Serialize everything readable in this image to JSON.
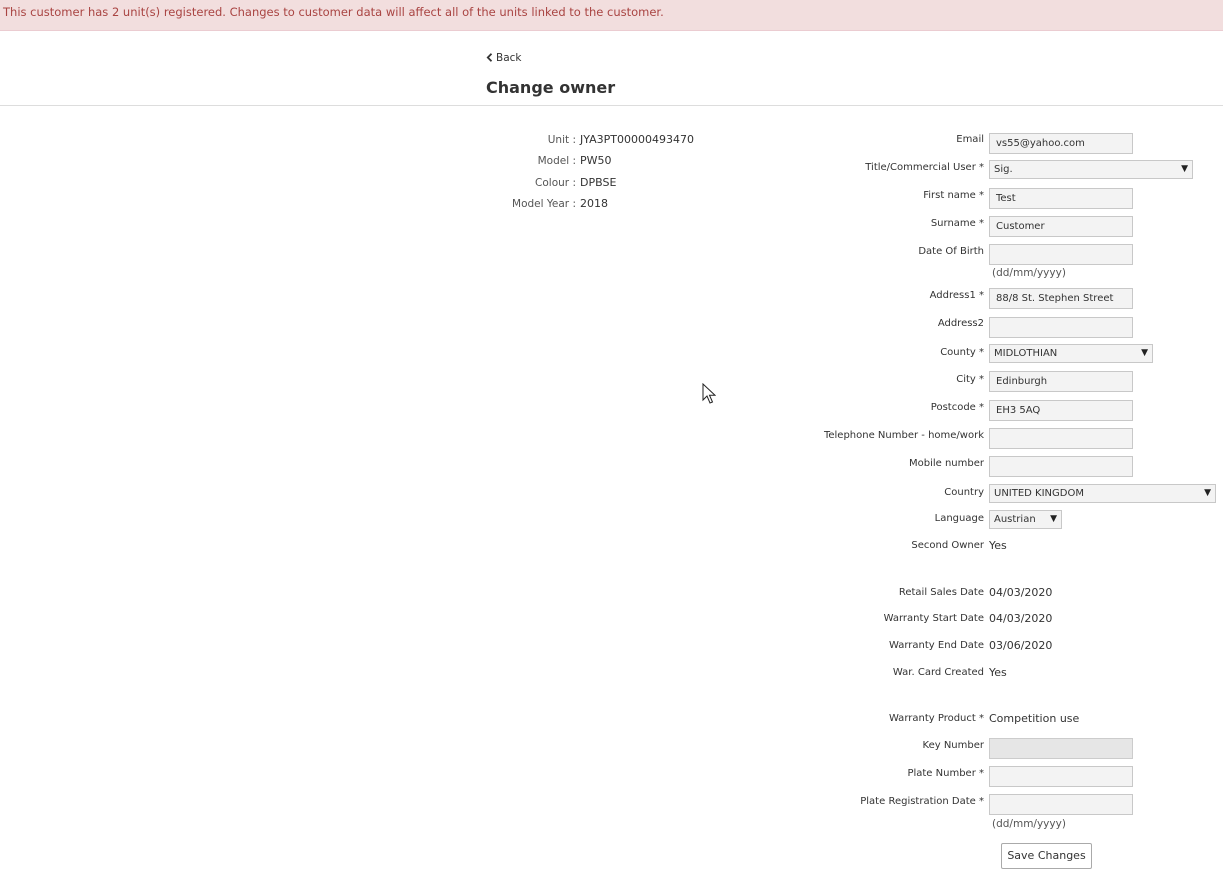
{
  "banner": {
    "message": "This customer has 2 unit(s) registered. Changes to customer data will affect all of the units linked to the customer."
  },
  "nav": {
    "back_label": "Back"
  },
  "page": {
    "title": "Change owner"
  },
  "unit_info": {
    "unit_label": "Unit :",
    "unit_value": "JYA3PT00000493470",
    "model_label": "Model :",
    "model_value": "PW50",
    "colour_label": "Colour :",
    "colour_value": "DPBSE",
    "model_year_label": "Model Year :",
    "model_year_value": "2018"
  },
  "form": {
    "email": {
      "label": "Email",
      "value": "vs55@yahoo.com"
    },
    "title": {
      "label": "Title/Commercial User *",
      "value": "Sig."
    },
    "first_name": {
      "label": "First name *",
      "value": "Test"
    },
    "surname": {
      "label": "Surname *",
      "value": "Customer"
    },
    "dob": {
      "label": "Date Of Birth",
      "value": "",
      "hint": "(dd/mm/yyyy)"
    },
    "address1": {
      "label": "Address1 *",
      "value": "88/8 St. Stephen Street"
    },
    "address2": {
      "label": "Address2",
      "value": ""
    },
    "county": {
      "label": "County *",
      "value": "MIDLOTHIAN"
    },
    "city": {
      "label": "City *",
      "value": "Edinburgh"
    },
    "postcode": {
      "label": "Postcode *",
      "value": "EH3 5AQ"
    },
    "telephone": {
      "label": "Telephone Number - home/work",
      "value": ""
    },
    "mobile": {
      "label": "Mobile number",
      "value": ""
    },
    "country": {
      "label": "Country",
      "value": "UNITED KINGDOM"
    },
    "language": {
      "label": "Language",
      "value": "Austrian"
    },
    "second_owner": {
      "label": "Second Owner",
      "value": "Yes"
    },
    "retail_sales_date": {
      "label": "Retail Sales Date",
      "value": "04/03/2020"
    },
    "warranty_start": {
      "label": "Warranty Start Date",
      "value": "04/03/2020"
    },
    "warranty_end": {
      "label": "Warranty End Date",
      "value": "03/06/2020"
    },
    "war_card": {
      "label": "War. Card Created",
      "value": "Yes"
    },
    "warranty_product": {
      "label": "Warranty Product *",
      "value": "Competition use"
    },
    "key_number": {
      "label": "Key Number",
      "value": ""
    },
    "plate_number": {
      "label": "Plate Number *",
      "value": ""
    },
    "plate_reg_date": {
      "label": "Plate Registration Date *",
      "value": "",
      "hint": "(dd/mm/yyyy)"
    }
  },
  "actions": {
    "save_label": "Save Changes"
  },
  "icons": {
    "back": "chevron-left-icon",
    "dropdown": "caret-down-icon",
    "cursor": "mouse-pointer-icon"
  },
  "colors": {
    "banner_bg": "#f2dede",
    "banner_text": "#a94442"
  }
}
